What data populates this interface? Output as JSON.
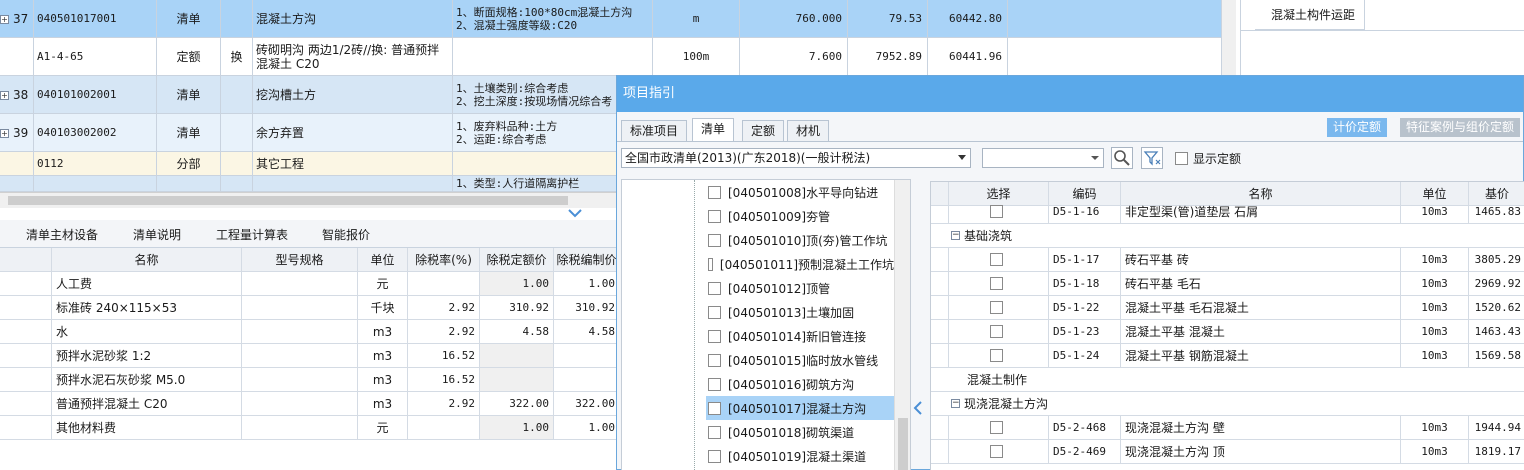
{
  "top_grid": {
    "rows": [
      {
        "no": "37",
        "code": "040501017001",
        "type": "清单",
        "tag": "",
        "name": "混凝土方沟",
        "feature": [
          "1、断面规格:100*80cm混凝土方沟",
          "2、混凝土强度等级:C20"
        ],
        "unit": "m",
        "qty": "760.000",
        "price": "79.53",
        "total": "60442.80"
      },
      {
        "no": "",
        "code": "A1-4-65",
        "type": "定额",
        "tag": "换",
        "name": "砖砌明沟 两边1/2砖//换: 普通预拌混凝土 C20",
        "feature": [],
        "unit": "100m",
        "qty": "7.600",
        "price": "7952.89",
        "total": "60441.96"
      },
      {
        "no": "38",
        "code": "040101002001",
        "type": "清单",
        "tag": "",
        "name": "挖沟槽土方",
        "feature": [
          "1、土壤类别:综合考虑",
          "2、挖土深度:按现场情况综合考"
        ],
        "unit": "",
        "qty": "",
        "price": "",
        "total": ""
      },
      {
        "no": "39",
        "code": "040103002002",
        "type": "清单",
        "tag": "",
        "name": "余方弃置",
        "feature": [
          "1、废弃料品种:土方",
          "2、运距:综合考虑"
        ],
        "unit": "",
        "qty": "",
        "price": "",
        "total": ""
      },
      {
        "no": "",
        "code": "0112",
        "type": "分部",
        "tag": "",
        "name": "其它工程",
        "feature": [],
        "unit": "",
        "qty": "",
        "price": "",
        "total": ""
      },
      {
        "no": "",
        "code": "",
        "type": "",
        "tag": "",
        "name": "",
        "feature": [
          "1、类型:人行道隔离护栏"
        ],
        "unit": "",
        "qty": "",
        "price": "",
        "total": ""
      }
    ]
  },
  "right_panel": {
    "item": "混凝土构件运距"
  },
  "bottom": {
    "tabs": [
      "清单主材设备",
      "清单说明",
      "工程量计算表",
      "智能报价"
    ],
    "headers": [
      "名称",
      "型号规格",
      "单位",
      "除税率(%)",
      "除税定额价",
      "除税编制价"
    ],
    "rows": [
      {
        "name": "人工费",
        "spec": "",
        "unit": "元",
        "rate": "",
        "quota": "1.00",
        "comp": "1.00"
      },
      {
        "name": "标准砖 240×115×53",
        "spec": "",
        "unit": "千块",
        "rate": "2.92",
        "quota": "310.92",
        "comp": "310.92"
      },
      {
        "name": "水",
        "spec": "",
        "unit": "m3",
        "rate": "2.92",
        "quota": "4.58",
        "comp": "4.58"
      },
      {
        "name": "预拌水泥砂浆 1:2",
        "spec": "",
        "unit": "m3",
        "rate": "16.52",
        "quota": "",
        "comp": ""
      },
      {
        "name": "预拌水泥石灰砂浆 M5.0",
        "spec": "",
        "unit": "m3",
        "rate": "16.52",
        "quota": "",
        "comp": ""
      },
      {
        "name": "普通预拌混凝土 C20",
        "spec": "",
        "unit": "m3",
        "rate": "2.92",
        "quota": "322.00",
        "comp": "322.00"
      },
      {
        "name": "其他材料费",
        "spec": "",
        "unit": "元",
        "rate": "",
        "quota": "1.00",
        "comp": "1.00"
      }
    ]
  },
  "dialog": {
    "title": "项目指引",
    "tabs": [
      "标准项目",
      "清单",
      "定额",
      "材机"
    ],
    "active_tab": "清单",
    "btn_quota": "计价定额",
    "btn_feature": "特征案例与组价定额",
    "list_select": "全国市政清单(2013)(广东2018)(一般计税法)",
    "search_value": "",
    "show_quota": "显示定额",
    "tree": [
      "[040501008]水平导向钻进",
      "[040501009]夯管",
      "[040501010]顶(夯)管工作坑",
      "[040501011]预制混凝土工作坑",
      "[040501012]顶管",
      "[040501013]土壤加固",
      "[040501014]新旧管连接",
      "[040501015]临时放水管线",
      "[040501016]砌筑方沟",
      "[040501017]混凝土方沟",
      "[040501018]砌筑渠道",
      "[040501019]混凝土渠道"
    ],
    "tree_selected": 9,
    "grid_headers": [
      "选择",
      "编码",
      "名称",
      "单位",
      "基价"
    ],
    "grid_rows": [
      {
        "kind": "item",
        "code": "D5-1-16",
        "name": "非定型渠(管)道垫层 石屑",
        "unit": "10m3",
        "price": "1465.83"
      },
      {
        "kind": "group",
        "label": "基础浇筑",
        "toggle": "−"
      },
      {
        "kind": "item",
        "code": "D5-1-17",
        "name": "砖石平基 砖",
        "unit": "10m3",
        "price": "3805.29"
      },
      {
        "kind": "item",
        "code": "D5-1-18",
        "name": "砖石平基 毛石",
        "unit": "10m3",
        "price": "2969.92"
      },
      {
        "kind": "item",
        "code": "D5-1-22",
        "name": "混凝土平基 毛石混凝土",
        "unit": "10m3",
        "price": "1520.62"
      },
      {
        "kind": "item",
        "code": "D5-1-23",
        "name": "混凝土平基 混凝土",
        "unit": "10m3",
        "price": "1463.43"
      },
      {
        "kind": "item",
        "code": "D5-1-24",
        "name": "混凝土平基 钢筋混凝土",
        "unit": "10m3",
        "price": "1569.58"
      },
      {
        "kind": "group",
        "label": "混凝土制作",
        "toggle": ""
      },
      {
        "kind": "group",
        "label": "现浇混凝土方沟",
        "toggle": "−"
      },
      {
        "kind": "item",
        "code": "D5-2-468",
        "name": "现浇混凝土方沟 壁",
        "unit": "10m3",
        "price": "1944.94"
      },
      {
        "kind": "item",
        "code": "D5-2-469",
        "name": "现浇混凝土方沟 顶",
        "unit": "10m3",
        "price": "1819.17"
      }
    ]
  },
  "colors": {
    "title_bar": "#5aa9ea",
    "selected_row": "#a9d3f7",
    "accent_btn": "#7ab8ee"
  }
}
